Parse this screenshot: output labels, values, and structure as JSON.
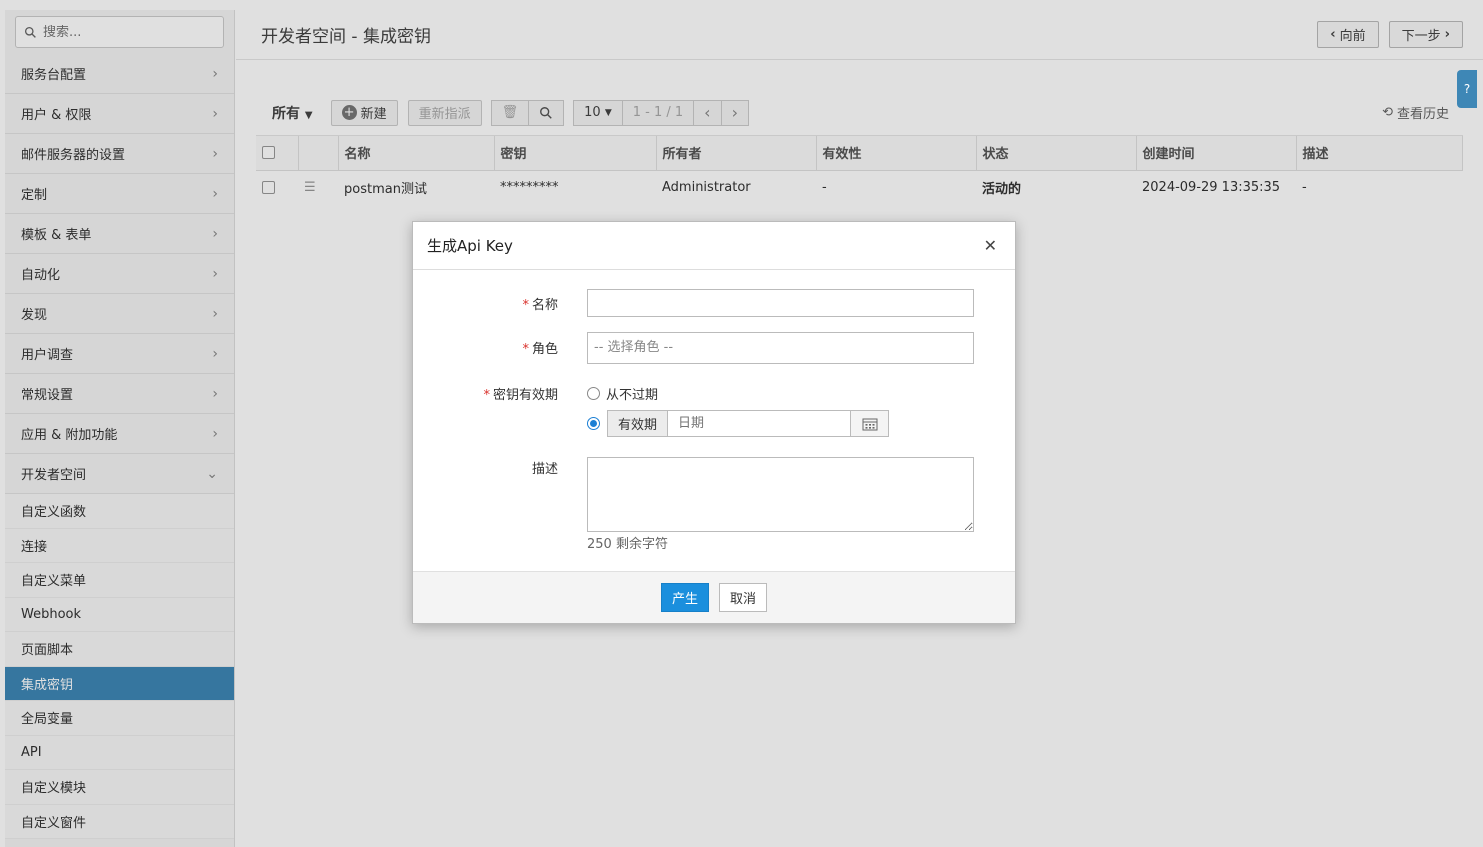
{
  "sidebar": {
    "search_placeholder": "搜索...",
    "menu": [
      {
        "label": "服务台配置"
      },
      {
        "label": "用户 & 权限"
      },
      {
        "label": "邮件服务器的设置"
      },
      {
        "label": "定制"
      },
      {
        "label": "模板 & 表单"
      },
      {
        "label": "自动化"
      },
      {
        "label": "发现"
      },
      {
        "label": "用户调查"
      },
      {
        "label": "常规设置"
      },
      {
        "label": "应用 & 附加功能"
      },
      {
        "label": "开发者空间"
      }
    ],
    "submenu": [
      {
        "label": "自定义函数"
      },
      {
        "label": "连接"
      },
      {
        "label": "自定义菜单"
      },
      {
        "label": "Webhook"
      },
      {
        "label": "页面脚本"
      },
      {
        "label": "集成密钥"
      },
      {
        "label": "全局变量"
      },
      {
        "label": "API"
      },
      {
        "label": "自定义模块"
      },
      {
        "label": "自定义窗件"
      }
    ]
  },
  "header": {
    "title": "开发者空间 - 集成密钥",
    "back_label": "向前",
    "next_label": "下一步"
  },
  "toolbar": {
    "filter_label": "所有",
    "new_label": "新建",
    "reassign_label": "重新指派",
    "page_size": "10",
    "page_info": "1 - 1 / 1",
    "history_label": "查看历史"
  },
  "table": {
    "columns": [
      "名称",
      "密钥",
      "所有者",
      "有效性",
      "状态",
      "创建时间",
      "描述"
    ],
    "rows": [
      [
        "postman测试",
        "*********",
        "Administrator",
        "-",
        "活动的",
        "2024-09-29 13:35:35",
        "-"
      ]
    ]
  },
  "modal": {
    "title": "生成Api Key",
    "name_label": "名称",
    "role_label": "角色",
    "role_placeholder": "-- 选择角色 --",
    "validity_label": "密钥有效期",
    "never_expire_label": "从不过期",
    "valid_until_label": "有效期",
    "date_placeholder": "日期",
    "description_label": "描述",
    "chars_remaining": "250 剩余字符",
    "generate_label": "产生",
    "cancel_label": "取消"
  },
  "colors": {
    "accent": "#3e87b6",
    "primary_button": "#1b8fdd",
    "active_status": "#3a9a3a",
    "required": "#d9302b"
  }
}
